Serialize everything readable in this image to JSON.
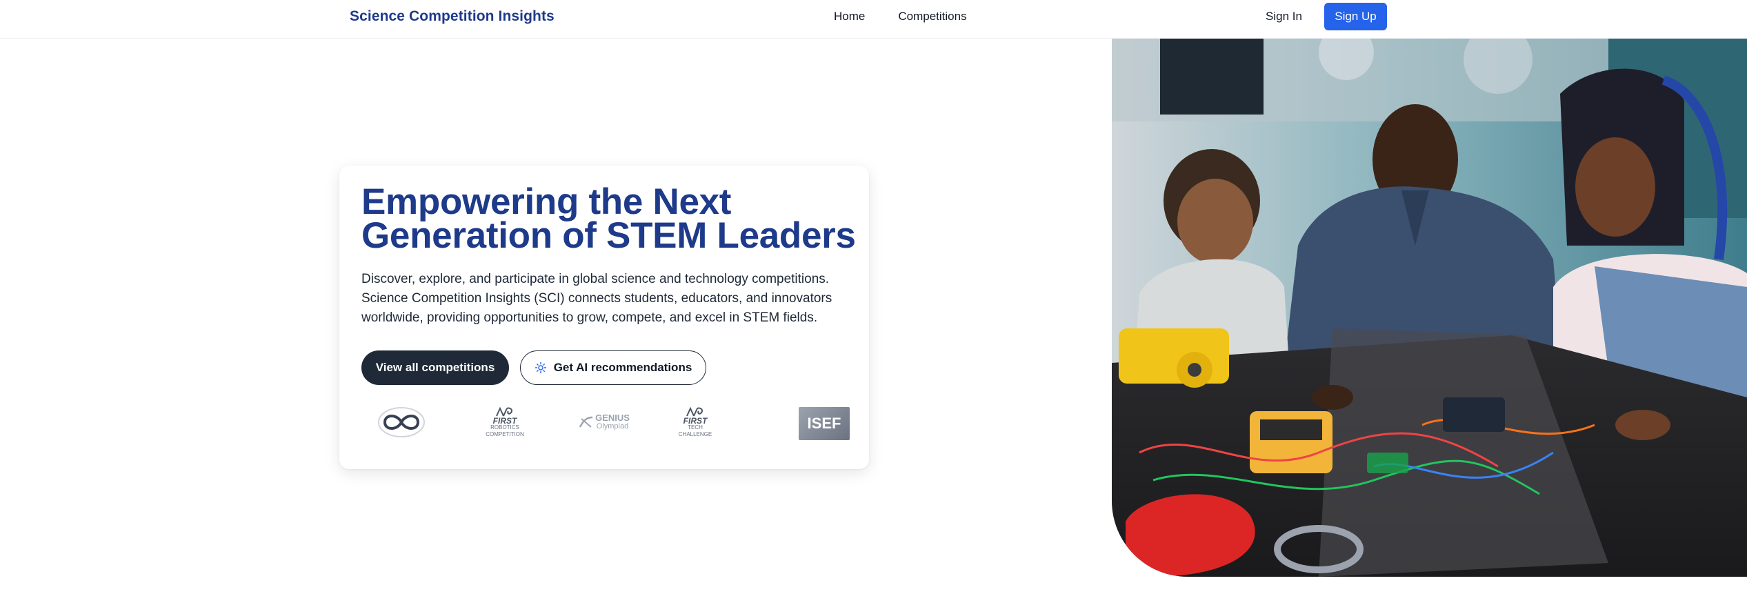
{
  "nav": {
    "brand": "Science Competition Insights",
    "links": [
      "Home",
      "Competitions"
    ],
    "sign_in": "Sign In",
    "sign_up": "Sign Up"
  },
  "hero": {
    "title": "Empowering the Next Generation of STEM Leaders",
    "description": "Discover, explore, and participate in global science and technology competitions. Science Competition Insights (SCI) connects students, educators, and innovators worldwide, providing opportunities to grow, compete, and excel in STEM fields.",
    "primary_button": "View all competitions",
    "secondary_button": "Get AI recommendations",
    "secondary_button_icon": "sparkle-icon"
  },
  "logos": {
    "first_robotics": [
      "FIRST",
      "ROBOTICS",
      "COMPETITION"
    ],
    "genius": [
      "GENIUS",
      "Olympiad"
    ],
    "first_tech": [
      "FIRST",
      "TECH",
      "CHALLENGE"
    ],
    "isef": "ISEF"
  },
  "colors": {
    "brand": "#1e3a8a",
    "primary": "#2563eb",
    "dark_button": "#1f2937"
  },
  "hero_image": {
    "alt": "Students and teacher working on robotics electronics"
  }
}
